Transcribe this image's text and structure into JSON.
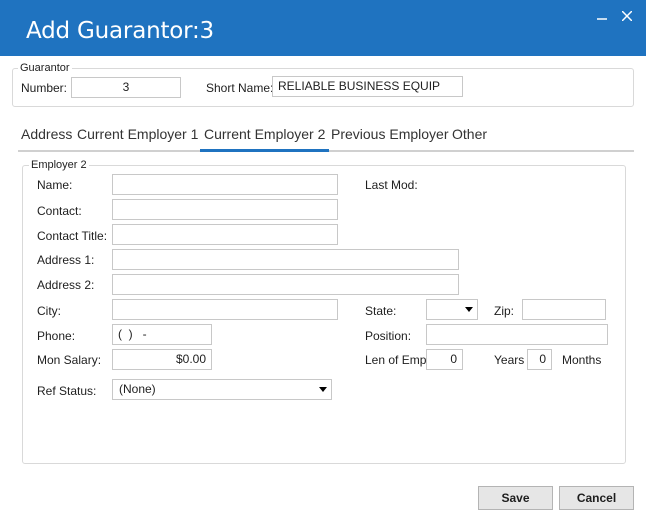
{
  "window": {
    "title": "Add Guarantor:3"
  },
  "guarantor": {
    "legend": "Guarantor",
    "number_label": "Number:",
    "number_value": "3",
    "short_name_label": "Short Name:",
    "short_name_value": "RELIABLE BUSINESS EQUIP"
  },
  "tabs": [
    {
      "label": "Address",
      "active": false
    },
    {
      "label": "Current Employer 1",
      "active": false
    },
    {
      "label": "Current Employer 2",
      "active": true
    },
    {
      "label": "Previous Employer",
      "active": false
    },
    {
      "label": "Other",
      "active": false
    }
  ],
  "employer": {
    "legend": "Employer 2",
    "name_label": "Name:",
    "name_value": "",
    "last_mod_label": "Last Mod:",
    "contact_label": "Contact:",
    "contact_value": "",
    "contact_title_label": "Contact Title:",
    "contact_title_value": "",
    "address1_label": "Address 1:",
    "address1_value": "",
    "address2_label": "Address 2:",
    "address2_value": "",
    "city_label": "City:",
    "city_value": "",
    "state_label": "State:",
    "state_value": "",
    "zip_label": "Zip:",
    "zip_value": "",
    "phone_label": "Phone:",
    "phone_value": "(  )   -",
    "position_label": "Position:",
    "position_value": "",
    "salary_label": "Mon Salary:",
    "salary_value": "$0.00",
    "len_emp_label": "Len of Emp:",
    "years_value": "0",
    "years_label": "Years",
    "months_value": "0",
    "months_label": "Months",
    "ref_status_label": "Ref Status:",
    "ref_status_value": "(None)"
  },
  "buttons": {
    "save": "Save",
    "cancel": "Cancel"
  }
}
